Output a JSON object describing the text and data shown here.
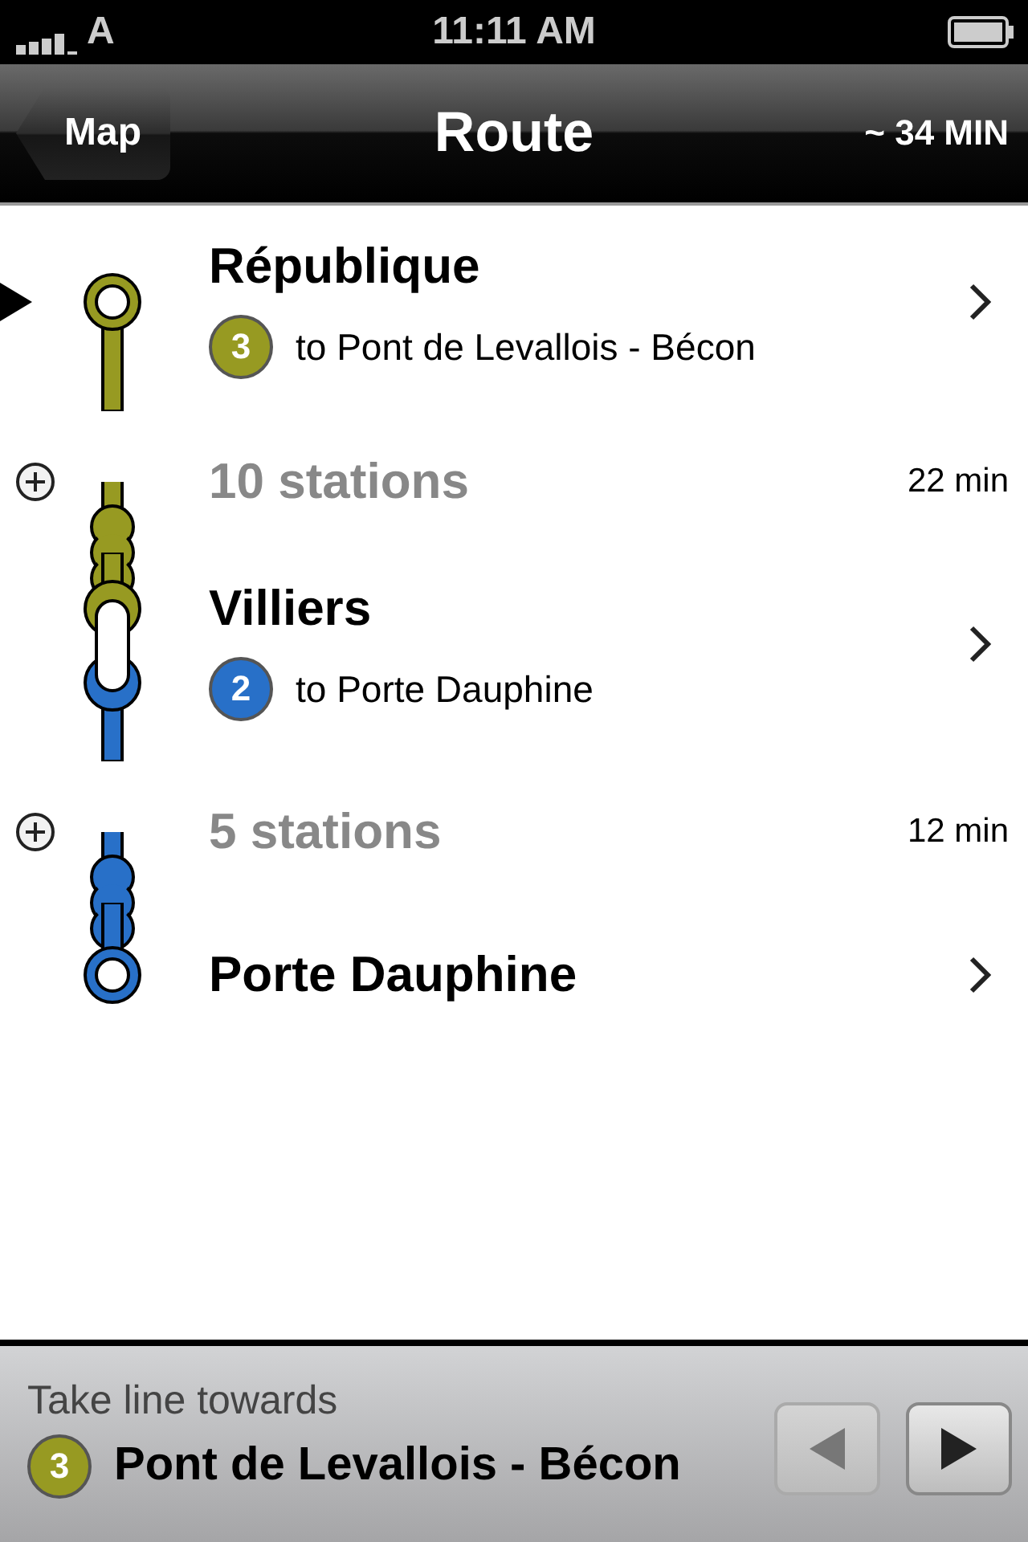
{
  "status_bar": {
    "carrier": "A",
    "time": "11:11 AM"
  },
  "nav_bar": {
    "back": "Map",
    "title": "Route",
    "duration": "~ 34 MIN"
  },
  "route": [
    {
      "kind": "station",
      "name": "République",
      "current": true,
      "line": {
        "number": "3",
        "color": "#979a22",
        "destination": "to Pont de Levallois - Bécon"
      }
    },
    {
      "kind": "segment",
      "stations": "10 stations",
      "time": "22 min",
      "color": "#979a22"
    },
    {
      "kind": "station",
      "name": "Villiers",
      "current": false,
      "line": {
        "number": "2",
        "color": "#2870c8",
        "destination": "to Porte Dauphine"
      }
    },
    {
      "kind": "segment",
      "stations": "5 stations",
      "time": "12 min",
      "color": "#2870c8"
    },
    {
      "kind": "station",
      "name": "Porte Dauphine",
      "current": false
    }
  ],
  "footer": {
    "label": "Take line towards",
    "line": {
      "number": "3",
      "color": "#979a22"
    },
    "destination": "Pont de Levallois - Bécon",
    "buttons": [
      {
        "kind": "previous",
        "disabled": true
      },
      {
        "kind": "next",
        "disabled": false
      }
    ]
  }
}
